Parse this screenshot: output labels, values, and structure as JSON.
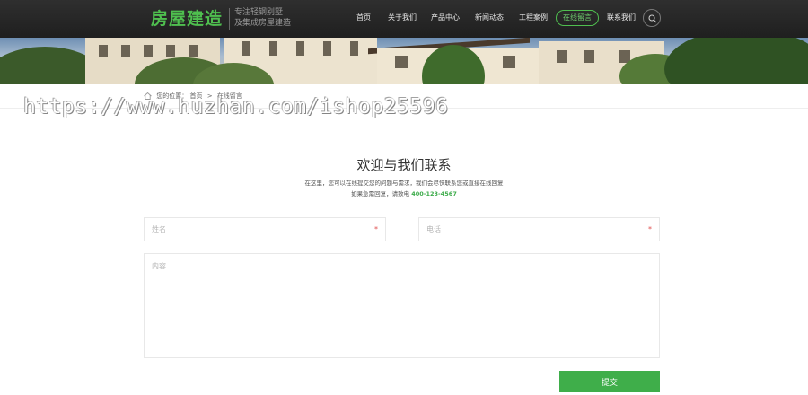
{
  "header": {
    "logo": "房屋建造",
    "tagline_line1": "专注轻钢别墅",
    "tagline_line2": "及集成房屋建造",
    "nav": [
      {
        "label": "首页"
      },
      {
        "label": "关于我们"
      },
      {
        "label": "产品中心"
      },
      {
        "label": "新闻动态"
      },
      {
        "label": "工程案例"
      },
      {
        "label": "在线留言",
        "active": true
      },
      {
        "label": "联系我们"
      }
    ],
    "search_icon": "search-icon"
  },
  "breadcrumb": {
    "prefix": "您的位置：",
    "home": "首页",
    "separator": ">",
    "current": "在线留言"
  },
  "watermark": "https://www.huzhan.com/ishop25596",
  "content": {
    "title": "欢迎与我们联系",
    "intro_line1": "在这里，您可以在线提交您的问题与需求，我们会尽快联系您或直接在线回复",
    "intro_line2_prefix": "如果急需回复，请致电",
    "phone": "400-123-4567"
  },
  "form": {
    "name_placeholder": "姓名",
    "phone_placeholder": "电话",
    "content_placeholder": "内容",
    "required_mark": "*",
    "submit_label": "提交"
  },
  "colors": {
    "accent": "#3fae4a",
    "header_bg": "#2a2a2a",
    "required": "#e05050"
  }
}
